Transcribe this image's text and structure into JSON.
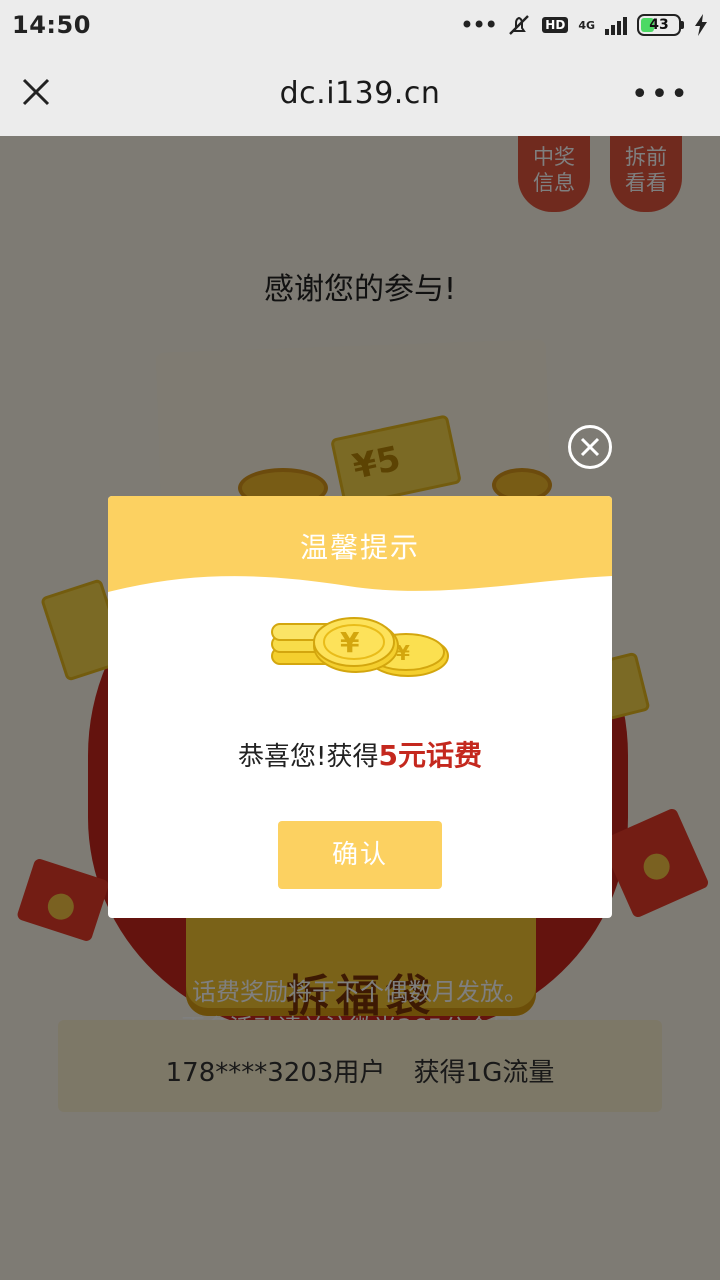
{
  "status_bar": {
    "time": "14:50",
    "network": "4G",
    "hd": "HD",
    "battery": "43",
    "battery_level": 0.43
  },
  "nav": {
    "url": "dc.i139.cn",
    "close_icon": "close-icon",
    "more_icon": "more-icon"
  },
  "page": {
    "prize_info_label": [
      "中奖",
      "信息"
    ],
    "peek_label": [
      "拆前",
      "看看"
    ],
    "thanks_text": "感谢您的参与!",
    "open_bag_label": "拆福袋",
    "notice_line1": "话费奖励将于下个偶数月发放。",
    "notice_line2": "更多活动请关注微光365公众号。",
    "winner_text": "178****3203用户 获得1G流量"
  },
  "dialog": {
    "title": "温馨提示",
    "message_prefix": "恭喜您!获得",
    "prize": "5元话费",
    "confirm_label": "确认",
    "close_icon": "close-circle-icon"
  },
  "colors": {
    "dialog_header": "#fcd161",
    "prize_text": "#c4281e",
    "overlay": "rgba(0,0,0,0.5)"
  }
}
